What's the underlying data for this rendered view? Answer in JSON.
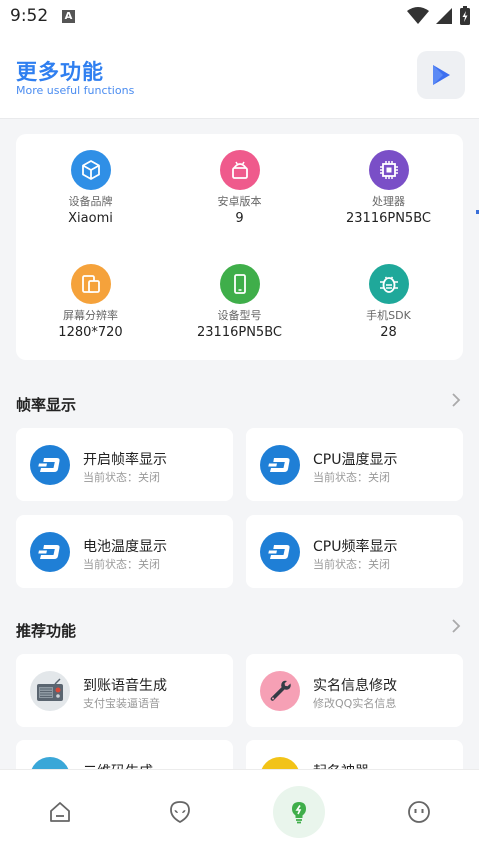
{
  "status_bar": {
    "time": "9:52",
    "badge": "A"
  },
  "header": {
    "title": "更多功能",
    "subtitle": "More useful functions"
  },
  "device_info": [
    {
      "label": "设备品牌",
      "value": "Xiaomi",
      "color": "#2f8fe6",
      "icon": "cube-icon"
    },
    {
      "label": "安卓版本",
      "value": "9",
      "color": "#ef5a8c",
      "icon": "android-icon"
    },
    {
      "label": "处理器",
      "value": "23116PN5BC",
      "color": "#7a4fc7",
      "icon": "cpu-icon"
    },
    {
      "label": "屏幕分辨率",
      "value": "1280*720",
      "color": "#f5a23b",
      "icon": "screen-icon"
    },
    {
      "label": "设备型号",
      "value": "23116PN5BC",
      "color": "#3fae4a",
      "icon": "phone-icon"
    },
    {
      "label": "手机SDK",
      "value": "28",
      "color": "#1fa89a",
      "icon": "bug-icon"
    }
  ],
  "sections": {
    "fps": {
      "title": "帧率显示"
    },
    "recommend": {
      "title": "推荐功能"
    }
  },
  "fps_items": [
    {
      "name": "开启帧率显示",
      "desc": "当前状态：关闭"
    },
    {
      "name": "CPU温度显示",
      "desc": "当前状态：关闭"
    },
    {
      "name": "电池温度显示",
      "desc": "当前状态：关闭"
    },
    {
      "name": "CPU频率显示",
      "desc": "当前状态：关闭"
    }
  ],
  "recommend_items": [
    {
      "name": "到账语音生成",
      "desc": "支付宝装逼语音",
      "icon": "radio-icon"
    },
    {
      "name": "实名信息修改",
      "desc": "修改QQ实名信息",
      "icon": "wrench-icon"
    },
    {
      "name": "二维码生成",
      "desc": "",
      "icon": "qrcode-icon"
    },
    {
      "name": "起名神器",
      "desc": "",
      "icon": "name-icon"
    }
  ],
  "nav": [
    {
      "name": "home",
      "icon": "home-icon"
    },
    {
      "name": "alien",
      "icon": "alien-icon"
    },
    {
      "name": "bulb",
      "icon": "bulb-icon"
    },
    {
      "name": "face",
      "icon": "face-icon"
    }
  ],
  "colors": {
    "accent": "#2f7ff0",
    "fps_icon": "#1f7fd6",
    "nav_active": "#3fae4a"
  }
}
